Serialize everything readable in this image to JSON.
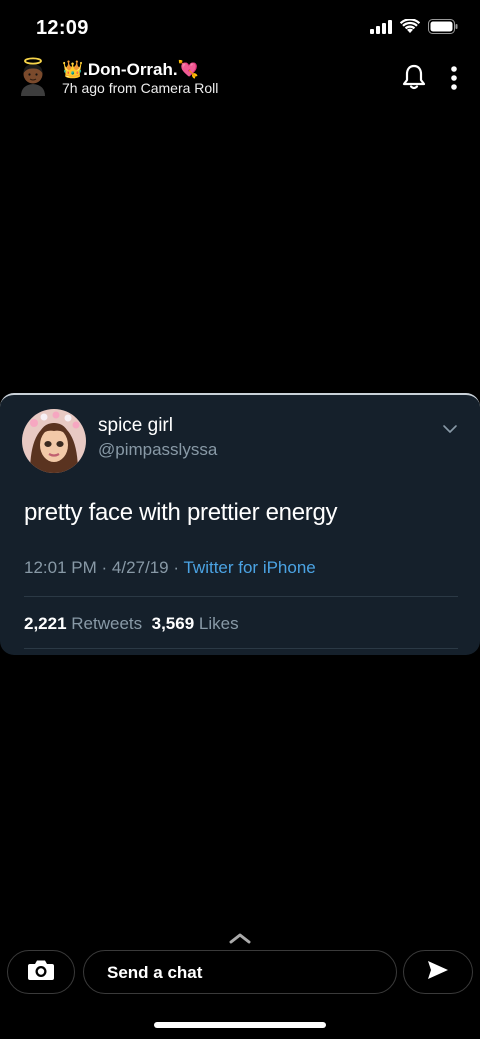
{
  "status_bar": {
    "time": "12:09"
  },
  "story": {
    "username": "👑.Don-Orrah.💘",
    "subtitle": "7h ago from Camera Roll"
  },
  "tweet": {
    "display_name": "spice girl",
    "handle": "@pimpasslyssa",
    "text": "pretty face with prettier energy",
    "time": "12:01 PM",
    "date": "4/27/19",
    "source": "Twitter for iPhone",
    "retweets_count": "2,221",
    "retweets_label": "Retweets",
    "likes_count": "3,569",
    "likes_label": "Likes",
    "separator": "·"
  },
  "chat": {
    "placeholder": "Send a chat"
  },
  "colors": {
    "card_bg": "#15202b",
    "secondary_text": "#8899a6",
    "link": "#4ba3e3"
  },
  "icons": [
    "signal-icon",
    "wifi-icon",
    "battery-icon",
    "bell-icon",
    "more-icon",
    "chevron-down-icon",
    "chevron-up-icon",
    "camera-icon",
    "send-icon"
  ]
}
